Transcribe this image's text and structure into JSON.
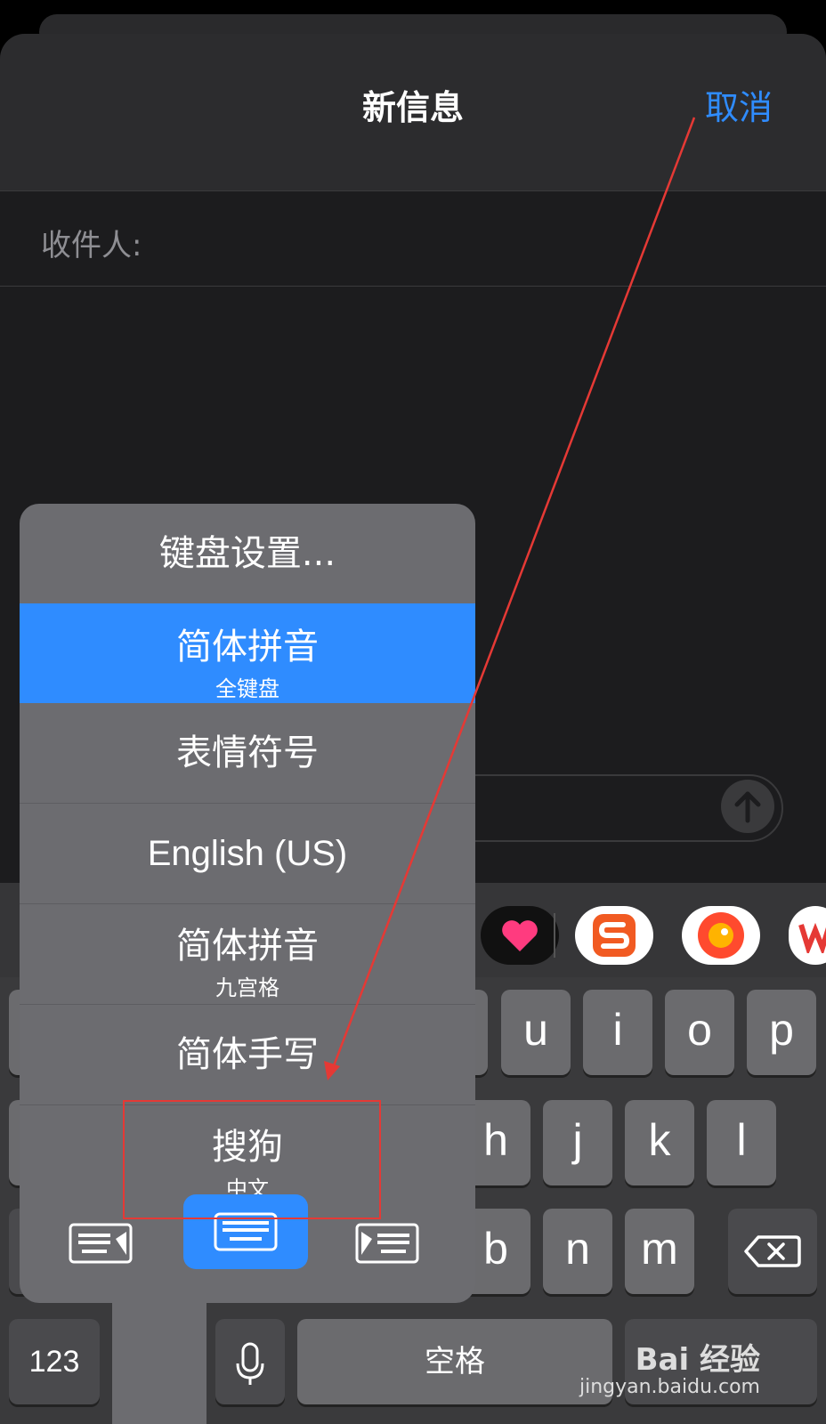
{
  "header": {
    "title": "新信息",
    "cancel_label": "取消"
  },
  "compose": {
    "recipient_label": "收件人:"
  },
  "input_menu": {
    "items": [
      {
        "label": "键盘设置...",
        "sub": ""
      },
      {
        "label": "简体拼音",
        "sub": "全键盘",
        "selected": true
      },
      {
        "label": "表情符号",
        "sub": ""
      },
      {
        "label": "English (US)",
        "sub": ""
      },
      {
        "label": "简体拼音",
        "sub": "九宫格"
      },
      {
        "label": "简体手写",
        "sub": ""
      },
      {
        "label": "搜狗",
        "sub": "中文"
      }
    ]
  },
  "keyboard": {
    "row1": [
      "u",
      "i",
      "o",
      "p"
    ],
    "row2": [
      "h",
      "j",
      "k",
      "l"
    ],
    "row3": [
      "b",
      "n",
      "m"
    ],
    "numbers_label": "123",
    "space_label": "空格"
  },
  "watermark": {
    "main": "Bai 经验",
    "sub": "jingyan.baidu.com"
  },
  "colors": {
    "accent": "#2f8cff",
    "annotation": "#e53935"
  },
  "icons": {
    "send": "arrow-up-icon",
    "backspace": "delete-left-icon",
    "mic": "microphone-icon",
    "keyboard_left": "keyboard-left-icon",
    "keyboard_full": "keyboard-icon",
    "keyboard_right": "keyboard-right-icon"
  }
}
